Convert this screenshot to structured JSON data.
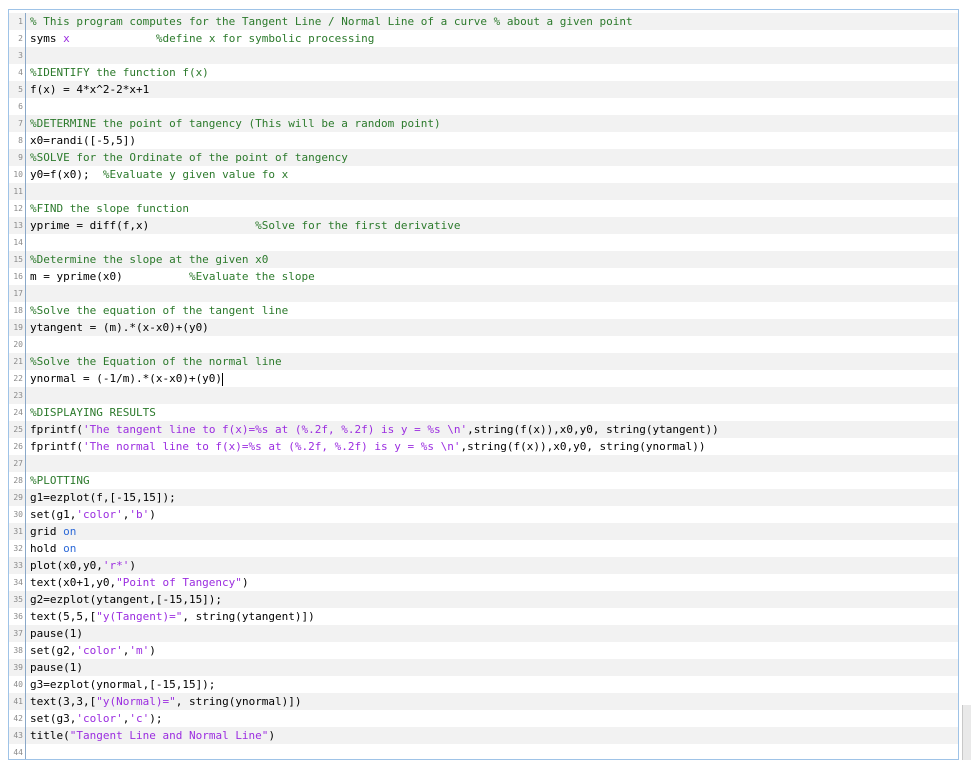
{
  "editor": {
    "lines": [
      {
        "n": "1",
        "tokens": [
          {
            "t": "comment",
            "v": "% This program computes for the Tangent Line / Normal Line of a curve % about a given point"
          }
        ]
      },
      {
        "n": "2",
        "tokens": [
          {
            "t": "plain",
            "v": "syms "
          },
          {
            "t": "string",
            "v": "x"
          },
          {
            "t": "plain",
            "v": "             "
          },
          {
            "t": "comment",
            "v": "%define x for symbolic processing"
          }
        ]
      },
      {
        "n": "3",
        "tokens": []
      },
      {
        "n": "4",
        "tokens": [
          {
            "t": "comment",
            "v": "%IDENTIFY the function f(x)"
          }
        ]
      },
      {
        "n": "5",
        "tokens": [
          {
            "t": "plain",
            "v": "f(x) = 4*x^2-2*x+1"
          }
        ]
      },
      {
        "n": "6",
        "tokens": []
      },
      {
        "n": "7",
        "tokens": [
          {
            "t": "comment",
            "v": "%DETERMINE the point of tangency (This will be a random point)"
          }
        ]
      },
      {
        "n": "8",
        "tokens": [
          {
            "t": "plain",
            "v": "x0=randi([-5,5])"
          }
        ]
      },
      {
        "n": "9",
        "tokens": [
          {
            "t": "comment",
            "v": "%SOLVE for the Ordinate of the point of tangency"
          }
        ]
      },
      {
        "n": "10",
        "tokens": [
          {
            "t": "plain",
            "v": "y0=f(x0);  "
          },
          {
            "t": "comment",
            "v": "%Evaluate y given value fo x"
          }
        ]
      },
      {
        "n": "11",
        "tokens": []
      },
      {
        "n": "12",
        "tokens": [
          {
            "t": "comment",
            "v": "%FIND the slope function"
          }
        ]
      },
      {
        "n": "13",
        "tokens": [
          {
            "t": "plain",
            "v": "yprime = diff(f,x)                "
          },
          {
            "t": "comment",
            "v": "%Solve for the first derivative"
          }
        ]
      },
      {
        "n": "14",
        "tokens": []
      },
      {
        "n": "15",
        "tokens": [
          {
            "t": "comment",
            "v": "%Determine the slope at the given x0"
          }
        ]
      },
      {
        "n": "16",
        "tokens": [
          {
            "t": "plain",
            "v": "m = yprime(x0)          "
          },
          {
            "t": "comment",
            "v": "%Evaluate the slope"
          }
        ]
      },
      {
        "n": "17",
        "tokens": []
      },
      {
        "n": "18",
        "tokens": [
          {
            "t": "comment",
            "v": "%Solve the equation of the tangent line"
          }
        ]
      },
      {
        "n": "19",
        "tokens": [
          {
            "t": "plain",
            "v": "ytangent = (m).*(x-x0)+(y0)"
          }
        ]
      },
      {
        "n": "20",
        "tokens": []
      },
      {
        "n": "21",
        "tokens": [
          {
            "t": "comment",
            "v": "%Solve the Equation of the normal line"
          }
        ]
      },
      {
        "n": "22",
        "tokens": [
          {
            "t": "plain",
            "v": "ynormal = (-1/m).*(x-x0)+(y0)"
          }
        ],
        "cursor": true
      },
      {
        "n": "23",
        "tokens": []
      },
      {
        "n": "24",
        "tokens": [
          {
            "t": "comment",
            "v": "%DISPLAYING RESULTS"
          }
        ]
      },
      {
        "n": "25",
        "tokens": [
          {
            "t": "plain",
            "v": "fprintf("
          },
          {
            "t": "string",
            "v": "'The tangent line to f(x)=%s at (%.2f, %.2f) is y = %s \\n'"
          },
          {
            "t": "plain",
            "v": ",string(f(x)),x0,y0, string(ytangent))"
          }
        ]
      },
      {
        "n": "26",
        "tokens": [
          {
            "t": "plain",
            "v": "fprintf("
          },
          {
            "t": "string",
            "v": "'The normal line to f(x)=%s at (%.2f, %.2f) is y = %s \\n'"
          },
          {
            "t": "plain",
            "v": ",string(f(x)),x0,y0, string(ynormal))"
          }
        ]
      },
      {
        "n": "27",
        "tokens": []
      },
      {
        "n": "28",
        "tokens": [
          {
            "t": "comment",
            "v": "%PLOTTING"
          }
        ]
      },
      {
        "n": "29",
        "tokens": [
          {
            "t": "plain",
            "v": "g1=ezplot(f,[-15,15]);"
          }
        ]
      },
      {
        "n": "30",
        "tokens": [
          {
            "t": "plain",
            "v": "set(g1,"
          },
          {
            "t": "string",
            "v": "'color'"
          },
          {
            "t": "plain",
            "v": ","
          },
          {
            "t": "string",
            "v": "'b'"
          },
          {
            "t": "plain",
            "v": ")"
          }
        ]
      },
      {
        "n": "31",
        "tokens": [
          {
            "t": "plain",
            "v": "grid "
          },
          {
            "t": "keyword",
            "v": "on"
          }
        ]
      },
      {
        "n": "32",
        "tokens": [
          {
            "t": "plain",
            "v": "hold "
          },
          {
            "t": "keyword",
            "v": "on"
          }
        ]
      },
      {
        "n": "33",
        "tokens": [
          {
            "t": "plain",
            "v": "plot(x0,y0,"
          },
          {
            "t": "string",
            "v": "'r*'"
          },
          {
            "t": "plain",
            "v": ")"
          }
        ]
      },
      {
        "n": "34",
        "tokens": [
          {
            "t": "plain",
            "v": "text(x0+1,y0,"
          },
          {
            "t": "string",
            "v": "\"Point of Tangency\""
          },
          {
            "t": "plain",
            "v": ")"
          }
        ]
      },
      {
        "n": "35",
        "tokens": [
          {
            "t": "plain",
            "v": "g2=ezplot(ytangent,[-15,15]);"
          }
        ]
      },
      {
        "n": "36",
        "tokens": [
          {
            "t": "plain",
            "v": "text(5,5,["
          },
          {
            "t": "string",
            "v": "\"y(Tangent)=\""
          },
          {
            "t": "plain",
            "v": ", string(ytangent)])"
          }
        ]
      },
      {
        "n": "37",
        "tokens": [
          {
            "t": "plain",
            "v": "pause(1)"
          }
        ]
      },
      {
        "n": "38",
        "tokens": [
          {
            "t": "plain",
            "v": "set(g2,"
          },
          {
            "t": "string",
            "v": "'color'"
          },
          {
            "t": "plain",
            "v": ","
          },
          {
            "t": "string",
            "v": "'m'"
          },
          {
            "t": "plain",
            "v": ")"
          }
        ]
      },
      {
        "n": "39",
        "tokens": [
          {
            "t": "plain",
            "v": "pause(1)"
          }
        ]
      },
      {
        "n": "40",
        "tokens": [
          {
            "t": "plain",
            "v": "g3=ezplot(ynormal,[-15,15]);"
          }
        ]
      },
      {
        "n": "41",
        "tokens": [
          {
            "t": "plain",
            "v": "text(3,3,["
          },
          {
            "t": "string",
            "v": "\"y(Normal)=\""
          },
          {
            "t": "plain",
            "v": ", string(ynormal)])"
          }
        ]
      },
      {
        "n": "42",
        "tokens": [
          {
            "t": "plain",
            "v": "set(g3,"
          },
          {
            "t": "string",
            "v": "'color'"
          },
          {
            "t": "plain",
            "v": ","
          },
          {
            "t": "string",
            "v": "'c'"
          },
          {
            "t": "plain",
            "v": ");"
          }
        ]
      },
      {
        "n": "43",
        "tokens": [
          {
            "t": "plain",
            "v": "title("
          },
          {
            "t": "string",
            "v": "\"Tangent Line and Normal Line\""
          },
          {
            "t": "plain",
            "v": ")"
          }
        ]
      },
      {
        "n": "44",
        "tokens": []
      }
    ]
  },
  "colors": {
    "comment": "#2c7a2c",
    "string": "#9b2de0",
    "keyword": "#2e6ad8",
    "line_alt": "#f2f2f2",
    "border": "#9fc3e7"
  }
}
